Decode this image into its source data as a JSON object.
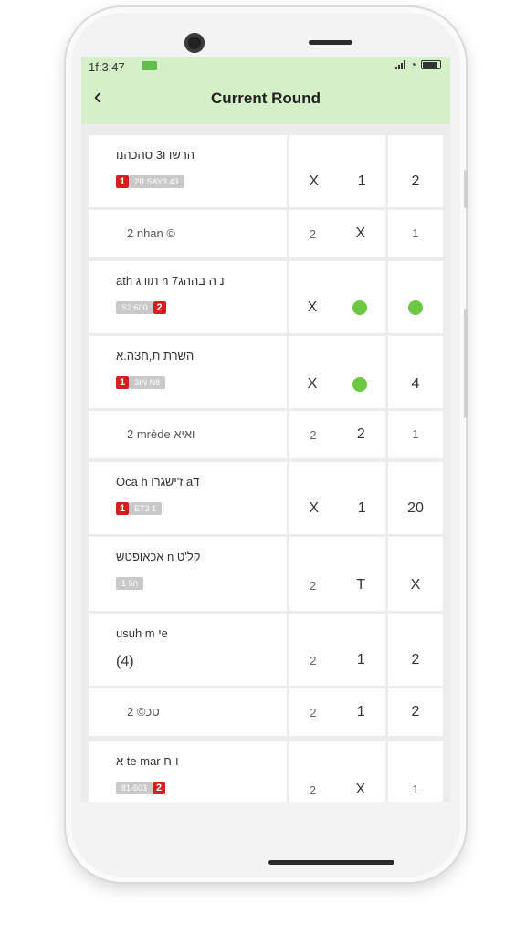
{
  "status": {
    "time": "1f:3:47"
  },
  "header": {
    "title": "Current Round",
    "back_label": "‹"
  },
  "rows": [
    {
      "name": "הרשו ו3 סהכהנו",
      "red": "1",
      "gray": "2B SAY3 43",
      "mid": [
        "X",
        "1"
      ],
      "last": "2"
    },
    {
      "sub": "2 nhan ©",
      "mid": [
        "2",
        "X"
      ],
      "last": "1"
    },
    {
      "name": "ath תוו ג n 7נ ה בההג",
      "gray": "S2:600",
      "red": "2",
      "mid": [
        "X",
        "dot"
      ],
      "last": "dot"
    },
    {
      "name": "השרת ת,ח3ה.א",
      "red": "1",
      "gray": "3IN N8",
      "mid": [
        "X",
        "dot"
      ],
      "last": "4"
    },
    {
      "sub": "2 mrède ואיא",
      "mid": [
        "2",
        "2"
      ],
      "last": "1"
    },
    {
      "name": "Oca h ז'ישגרו aד",
      "red": "1",
      "gray": "ET3 1",
      "mid": [
        "X",
        "1"
      ],
      "last": "20"
    },
    {
      "name": "אכאופטש n קל'ט",
      "gray": "1 ה6",
      "mid": [
        "2",
        "T"
      ],
      "last": "X"
    },
    {
      "name": "usuh m יe",
      "plain": "(4)",
      "mid": [
        "2",
        "1"
      ],
      "last": "2"
    },
    {
      "sub": "2 ©טכ",
      "mid": [
        "2",
        "1"
      ],
      "last": "2"
    },
    {
      "name": "א te mar ו-ח",
      "gray": "81-603",
      "red": "2",
      "mid": [
        "2",
        "X"
      ],
      "last": "1"
    }
  ],
  "colors": {
    "header_bg": "#d5efc9",
    "badge_red": "#d51e1e",
    "dot_green": "#6cc742"
  }
}
